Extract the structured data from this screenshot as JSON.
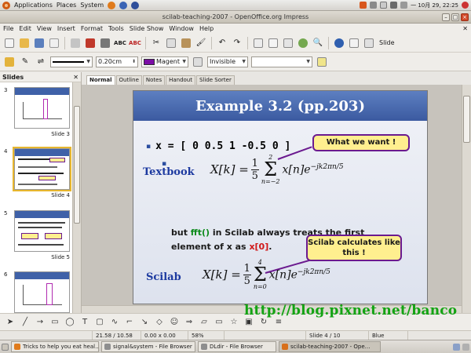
{
  "top_panel": {
    "menus": [
      "Applications",
      "Places",
      "System"
    ],
    "clock": "一 10月 29, 22:25"
  },
  "window": {
    "title": "scilab-teaching-2007 - OpenOffice.org Impress"
  },
  "menubar": [
    "File",
    "Edit",
    "View",
    "Insert",
    "Format",
    "Tools",
    "Slide Show",
    "Window",
    "Help"
  ],
  "toolbar": {
    "slide_label": "Slide"
  },
  "format_toolbar": {
    "line_width": "0.20cm",
    "color_name": "Magent",
    "area_style": "Invisible",
    "colors": {
      "line_color": "#7b0ea6"
    }
  },
  "slides_pane": {
    "title": "Slides",
    "thumbnails": [
      {
        "number": "3",
        "label": "Slide 3"
      },
      {
        "number": "4",
        "label": "Slide 4"
      },
      {
        "number": "5",
        "label": "Slide 5"
      },
      {
        "number": "6",
        "label": ""
      }
    ]
  },
  "view_tabs": [
    "Normal",
    "Outline",
    "Notes",
    "Handout",
    "Slide Sorter"
  ],
  "slide": {
    "title": "Example 3.2 (pp.203)",
    "bullet": "x = [ 0  0.5  1  -0.5  0 ]",
    "callout_1": "What we want !",
    "textbook_label": "Textbook",
    "formula_1": {
      "lhs": "X[k] =",
      "num": "1",
      "den": "5",
      "sum_top": "2",
      "sum_bottom": "n=−2",
      "rhs": "x[n]e",
      "exp": "−jk2πn/5"
    },
    "body_line_1_a": "but ",
    "body_fft": "fft()",
    "body_line_1_b": " in Scilab always treats the first",
    "body_line_2_a": "element of x as ",
    "body_x0": "x[0]",
    "body_line_2_b": ".",
    "callout_2": "Scilab calculates like this !",
    "scilab_label": "Scilab",
    "formula_2": {
      "lhs": "X[k] =",
      "num": "1",
      "den": "5",
      "sum_top": "4",
      "sum_bottom": "n=0",
      "rhs": "x[n]e",
      "exp": "−jk2πn/5"
    }
  },
  "watermark": "http://blog.pixnet.net/banco",
  "statusbar": {
    "position": "21.58 / 10.58",
    "size": "0.00 x 0.00",
    "zoom": "58%",
    "slide_indicator": "Slide 4 / 10",
    "layout": "Blue"
  },
  "taskbar": [
    {
      "label": "Tricks to help you eat heal…",
      "active": false
    },
    {
      "label": "signal&system - File Browser",
      "active": false
    },
    {
      "label": "DLdir - File Browser",
      "active": false
    },
    {
      "label": "scilab-teaching-2007 - Ope…",
      "active": true
    }
  ]
}
